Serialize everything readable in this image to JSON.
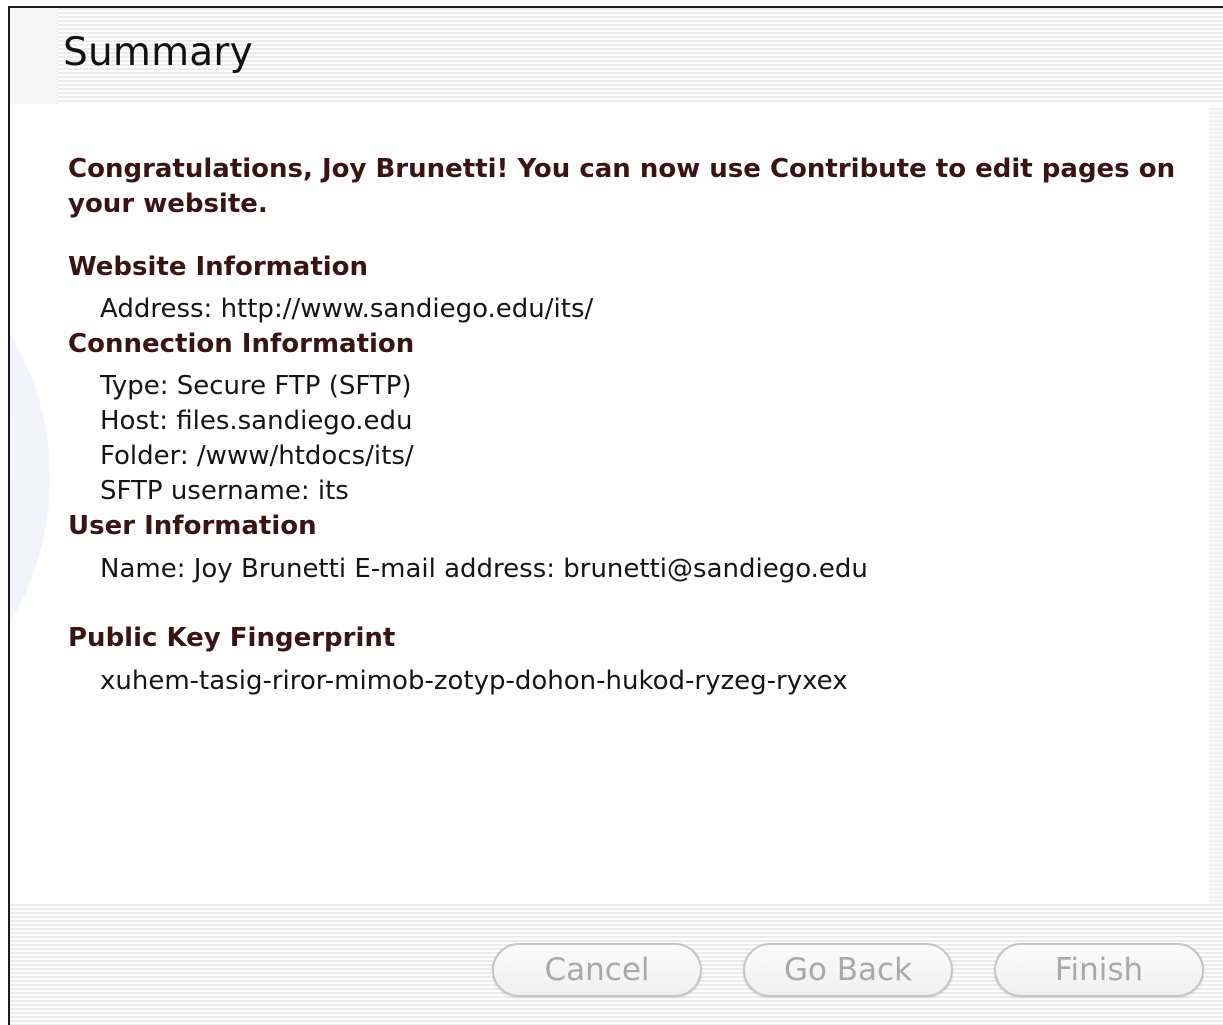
{
  "title": "Summary",
  "congrats": "Congratulations, Joy Brunetti! You can now use Contribute to edit pages on your website.",
  "website": {
    "heading": "Website Information",
    "address": "Address: http://www.sandiego.edu/its/"
  },
  "connection": {
    "heading": "Connection Information",
    "type": "Type: Secure FTP (SFTP)",
    "host": "Host: files.sandiego.edu",
    "folder": "Folder: /www/htdocs/its/",
    "username": "SFTP username: its"
  },
  "user": {
    "heading": "User Information",
    "details": "Name: Joy Brunetti E-mail address: brunetti@sandiego.edu"
  },
  "fingerprint": {
    "heading": "Public Key Fingerprint",
    "value": "xuhem-tasig-riror-mimob-zotyp-dohon-hukod-ryzeg-ryxex"
  },
  "buttons": {
    "cancel": "Cancel",
    "go_back": "Go Back",
    "finish": "Finish"
  },
  "colors": {
    "heading_text": "#3a1414",
    "disabled_button_text": "#a9a9a9"
  }
}
